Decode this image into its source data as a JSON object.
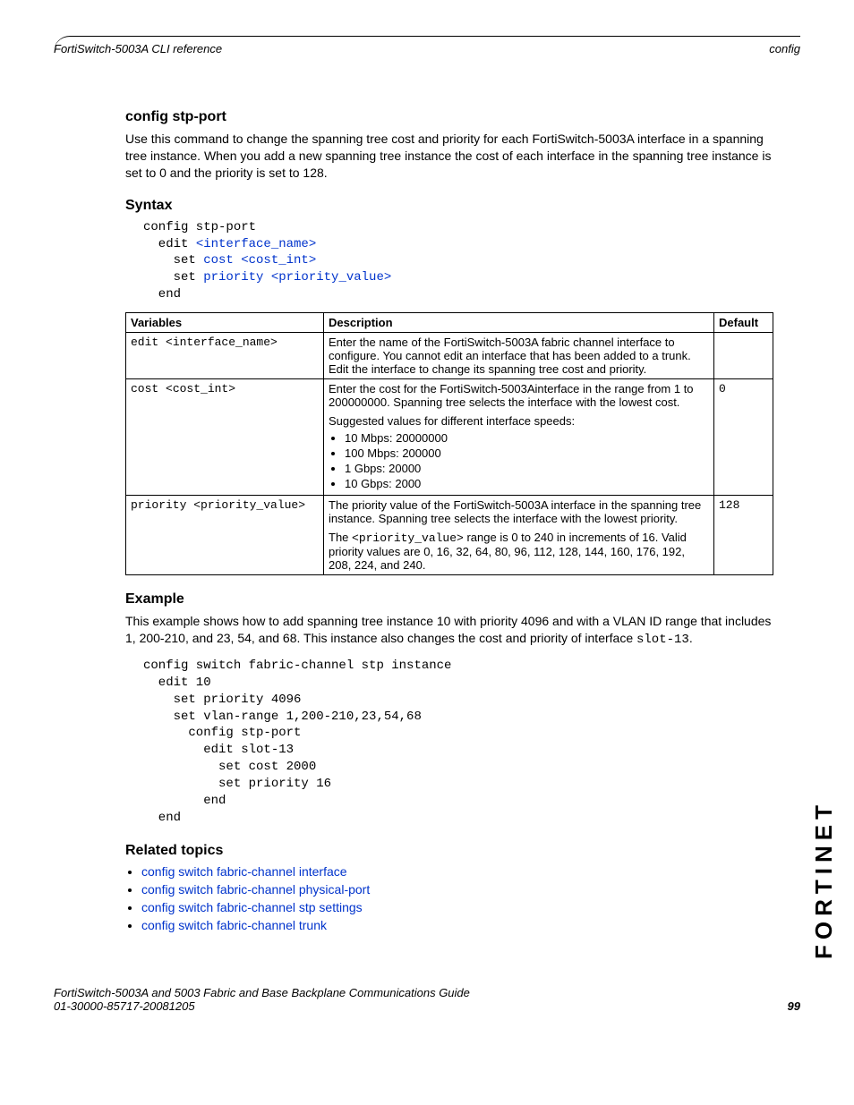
{
  "header": {
    "left": "FortiSwitch-5003A CLI reference",
    "right": "config"
  },
  "section1": {
    "title": "config stp-port",
    "intro": "Use this command to change the spanning tree cost and priority for each FortiSwitch-5003A interface in a spanning tree instance. When you add a new spanning tree instance the cost of each interface in the spanning tree instance is set to 0 and the priority is set to 128."
  },
  "syntax": {
    "title": "Syntax",
    "l1": "config stp-port",
    "l2a": "  edit ",
    "l2b": "<interface_name>",
    "l3a": "    set ",
    "l3b": "cost <cost_int>",
    "l4a": "    set ",
    "l4b": "priority <priority_value>",
    "l5": "  end"
  },
  "table": {
    "h1": "Variables",
    "h2": "Description",
    "h3": "Default",
    "r1": {
      "var_a": "edit ",
      "var_b": "<interface_name>",
      "desc": "Enter the name of the FortiSwitch-5003A fabric channel interface to configure. You cannot edit an interface that has been added to a trunk. Edit the interface to change its spanning tree cost and priority.",
      "def": ""
    },
    "r2": {
      "var_a": "cost ",
      "var_b": "<cost_int>",
      "desc_p1": "Enter the cost for the FortiSwitch-5003Ainterface in the range from 1 to 200000000. Spanning tree selects the interface with the lowest cost.",
      "desc_p2": "Suggested values for different interface speeds:",
      "b1": "10 Mbps: 20000000",
      "b2": "100 Mbps: 200000",
      "b3": "1 Gbps: 20000",
      "b4": "10 Gbps: 2000",
      "def": "0"
    },
    "r3": {
      "var_a": "priority ",
      "var_b": "<priority_value>",
      "desc_p1": "The priority value of the FortiSwitch-5003A interface in the spanning tree instance. Spanning tree selects the interface with the lowest priority.",
      "desc_p2a": "The ",
      "desc_p2b": "<priority_value>",
      "desc_p2c": " range is 0 to 240 in increments of 16. Valid priority values are 0, 16, 32, 64, 80, 96, 112, 128, 144, 160, 176, 192, 208, 224, and 240.",
      "def": "128"
    }
  },
  "example": {
    "title": "Example",
    "intro_a": "This example shows how to add spanning tree instance 10 with priority 4096 and with a VLAN ID range that includes 1, 200-210, and 23, 54, and 68. This instance also changes the cost and priority of interface ",
    "intro_b": "slot-13",
    "intro_c": ".",
    "code": "config switch fabric-channel stp instance\n  edit 10\n    set priority 4096\n    set vlan-range 1,200-210,23,54,68\n      config stp-port\n        edit slot-13\n          set cost 2000\n          set priority 16\n        end\n  end"
  },
  "related": {
    "title": "Related topics",
    "l1": "config switch fabric-channel interface",
    "l2": "config switch fabric-channel physical-port",
    "l3": "config switch fabric-channel stp settings",
    "l4": "config switch fabric-channel trunk"
  },
  "footer": {
    "line1": "FortiSwitch-5003A and 5003   Fabric and Base Backplane Communications Guide",
    "line2": "01-30000-85717-20081205",
    "page": "99"
  },
  "logo": "FORTINET"
}
